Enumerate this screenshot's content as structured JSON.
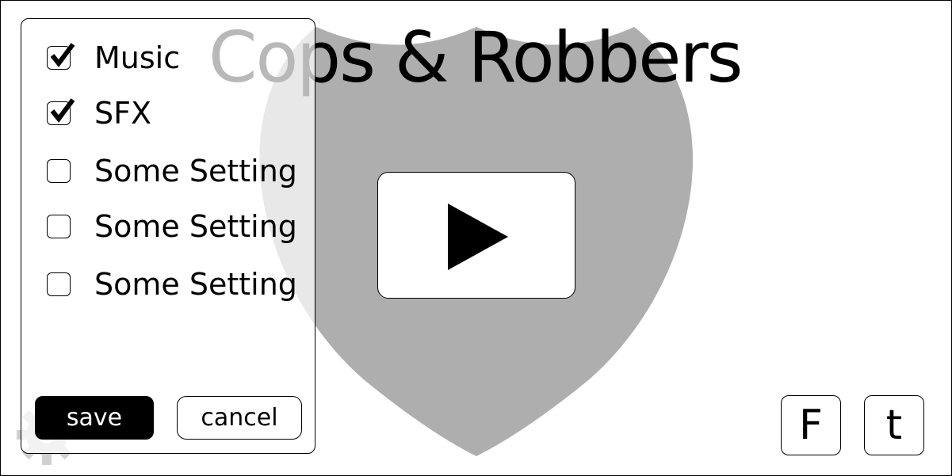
{
  "title": "Cops & Robbers",
  "icons": {
    "shield": "shield-icon",
    "play": "play-icon",
    "gear": "gear-icon",
    "checkmark": "checkmark-icon"
  },
  "colors": {
    "shield": "#aeaeae",
    "panel_background": "#ffffff",
    "save_button": "#000000",
    "text": "#000000"
  },
  "social": {
    "facebook_label": "F",
    "twitter_label": "t"
  },
  "settings": {
    "items": [
      {
        "label": "Music",
        "checked": true
      },
      {
        "label": "SFX",
        "checked": true
      },
      {
        "label": "Some Setting",
        "checked": false
      },
      {
        "label": "Some Setting",
        "checked": false
      },
      {
        "label": "Some Setting",
        "checked": false
      }
    ],
    "save_label": "save",
    "cancel_label": "cancel"
  }
}
